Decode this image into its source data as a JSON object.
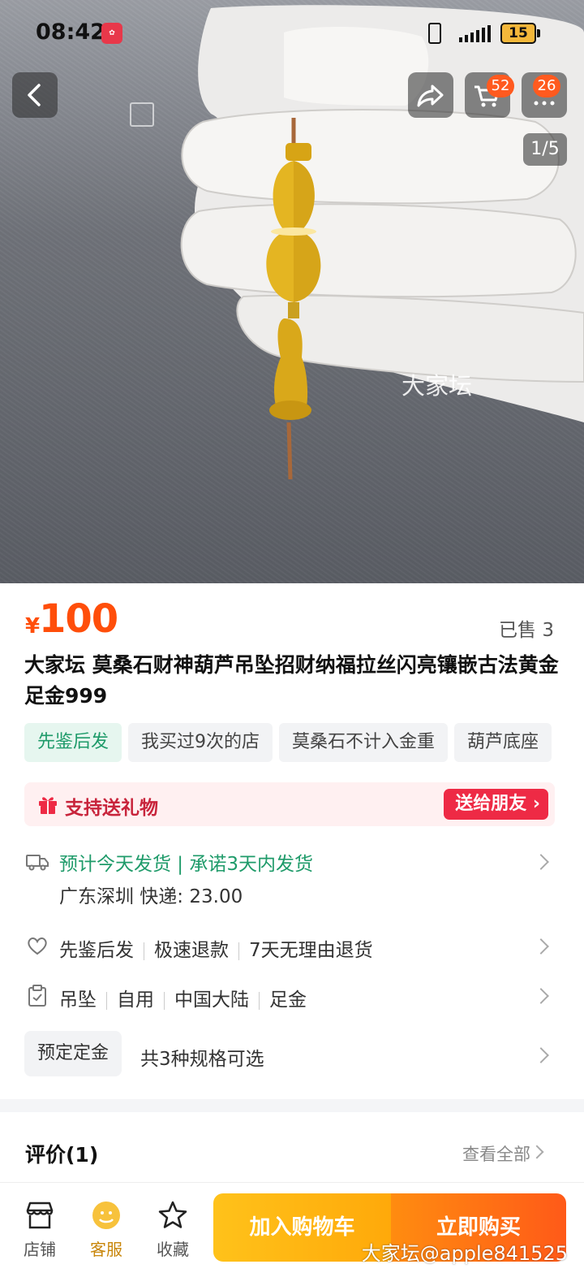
{
  "status_bar": {
    "time": "08:42",
    "battery": "15"
  },
  "nav": {
    "cart_badge": "52",
    "message_badge": "26",
    "image_counter": "1/5",
    "image_watermark": "大家坛"
  },
  "product": {
    "price_symbol": "¥",
    "price": "100",
    "sold": "已售 3",
    "title": "大家坛 莫桑石财神葫芦吊坠招财纳福拉丝闪亮镶嵌古法黄金足金999",
    "tags": [
      {
        "label": "先鉴后发",
        "style": "green"
      },
      {
        "label": "我买过9次的店",
        "style": "gray"
      },
      {
        "label": "莫桑石不计入金重",
        "style": "gray"
      },
      {
        "label": "葫芦底座",
        "style": "gray"
      }
    ]
  },
  "gift": {
    "label": "支持送礼物",
    "button": "送给朋友"
  },
  "shipping": {
    "main": "预计今天发货 | 承诺3天内发货",
    "sub": "广东深圳  快递: 23.00"
  },
  "guarantees": [
    "先鉴后发",
    "极速退款",
    "7天无理由退货"
  ],
  "params": [
    "吊坠",
    "自用",
    "中国大陆",
    "足金"
  ],
  "specs": {
    "chip": "预定定金",
    "text": "共3种规格可选"
  },
  "reviews": {
    "title": "评价(1)",
    "view_all": "查看全部"
  },
  "bottom_bar": {
    "shop": "店铺",
    "service": "客服",
    "favorite": "收藏",
    "add_to_cart": "加入购物车",
    "buy_now": "立即购买"
  },
  "watermark": "大家坛@apple841525",
  "colors": {
    "price": "#ff4e0a",
    "green": "#1f9b6a",
    "gift": "#ee2a45",
    "cart_cta": "#ffb414",
    "buy_cta": "#ff6a14"
  }
}
